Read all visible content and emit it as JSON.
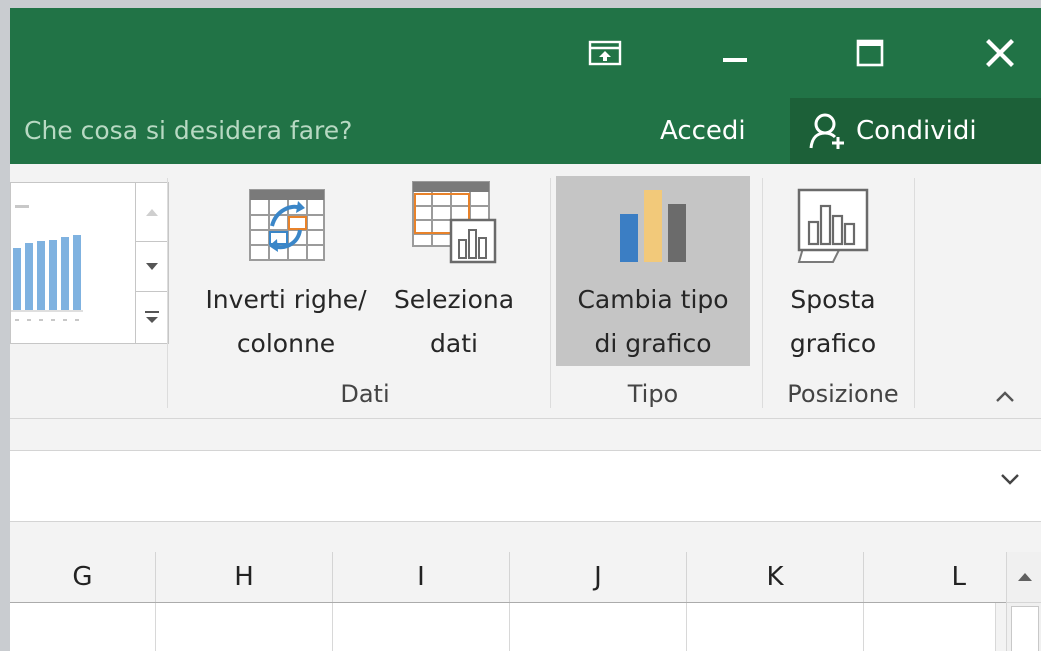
{
  "tellbar": {
    "search_placeholder": "Che cosa si desidera fare?",
    "signin_label": "Accedi",
    "share_label": "Condividi"
  },
  "ribbon": {
    "groups": {
      "dati": {
        "label": "Dati",
        "switch_label": "Inverti righe/\ncolonne",
        "select_label": "Seleziona\ndati"
      },
      "tipo": {
        "label": "Tipo",
        "change_label": "Cambia tipo\ndi grafico"
      },
      "posizione": {
        "label": "Posizione",
        "move_label": "Sposta\ngrafico"
      }
    }
  },
  "grid": {
    "columns": [
      "G",
      "H",
      "I",
      "J",
      "K",
      "L"
    ]
  },
  "colors": {
    "excel_green": "#217346",
    "share_bg": "#1c6038",
    "selected_button": "#c5c5c5"
  }
}
